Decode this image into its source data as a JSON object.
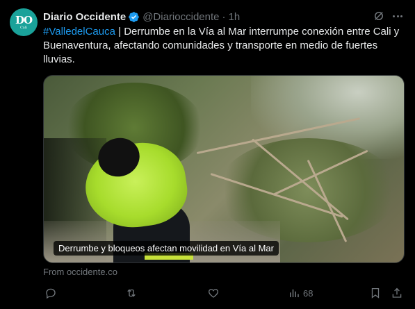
{
  "account": {
    "name": "Diario Occidente",
    "handle": "@Diarioccidente",
    "separator": "·",
    "time": "1h",
    "avatar_monogram": "DO",
    "avatar_sub": "Cali"
  },
  "tweet": {
    "hashtag": "#ValledelCauca",
    "text": " | Derrumbe en la Vía al Mar interrumpe conexión entre Cali y Buenaventura, afectando comunidades y transporte en medio de fuertes lluvias."
  },
  "media": {
    "caption": "Derrumbe y bloqueos afectan movilidad en Vía al Mar"
  },
  "source": "From occidente.co",
  "actions": {
    "views_count": "68"
  },
  "icons": [
    "verified-badge-icon",
    "grok-icon",
    "more-icon",
    "reply-icon",
    "repost-icon",
    "like-icon",
    "views-icon",
    "bookmark-icon",
    "share-icon"
  ],
  "colors": {
    "background": "#000000",
    "text": "#e7e9ea",
    "muted": "#71767b",
    "accent": "#1d9bf0",
    "avatar": "#1aa29a"
  }
}
